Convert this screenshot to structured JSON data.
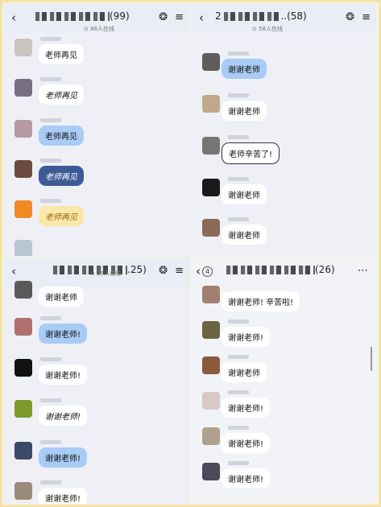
{
  "panels": [
    {
      "title_suffix": "(99)",
      "online": "⊙ 86人在线",
      "messages": [
        "老师再见",
        "老师再见",
        "老师再见",
        "老师再见",
        "老师再见"
      ]
    },
    {
      "title_prefix": "2",
      "title_suffix": "..(58)",
      "online": "⊙ 58人在线",
      "messages": [
        "谢谢老师",
        "谢谢老师",
        "老师辛苦了!",
        "谢谢老师",
        "谢谢老师"
      ]
    },
    {
      "title_suffix": ".25)",
      "online": "⊙ 25人在线",
      "messages": [
        "谢谢老师",
        "谢谢老师!",
        "谢谢老师!",
        "谢谢老师!",
        "谢谢老师!",
        "谢谢老师!"
      ]
    },
    {
      "badge": "4",
      "title_suffix": "(26)",
      "messages": [
        "谢谢老师! 辛苦啦!",
        "谢谢老师!",
        "谢谢老师",
        "谢谢老师!",
        "谢谢老师!",
        "谢谢老师!"
      ]
    }
  ],
  "icons": {
    "back": "chevron-left-icon",
    "bell": "bell-icon",
    "menu": "menu-icon",
    "more": "more-icon"
  },
  "colors": {
    "header": "#e9edf5",
    "chat_bg": "#eef0f6",
    "bubble_blue": "#a8ccf5",
    "bubble_navy": "#3e5a96",
    "bubble_yellow": "#fbe7a7",
    "frame": "#f3e3a8"
  }
}
